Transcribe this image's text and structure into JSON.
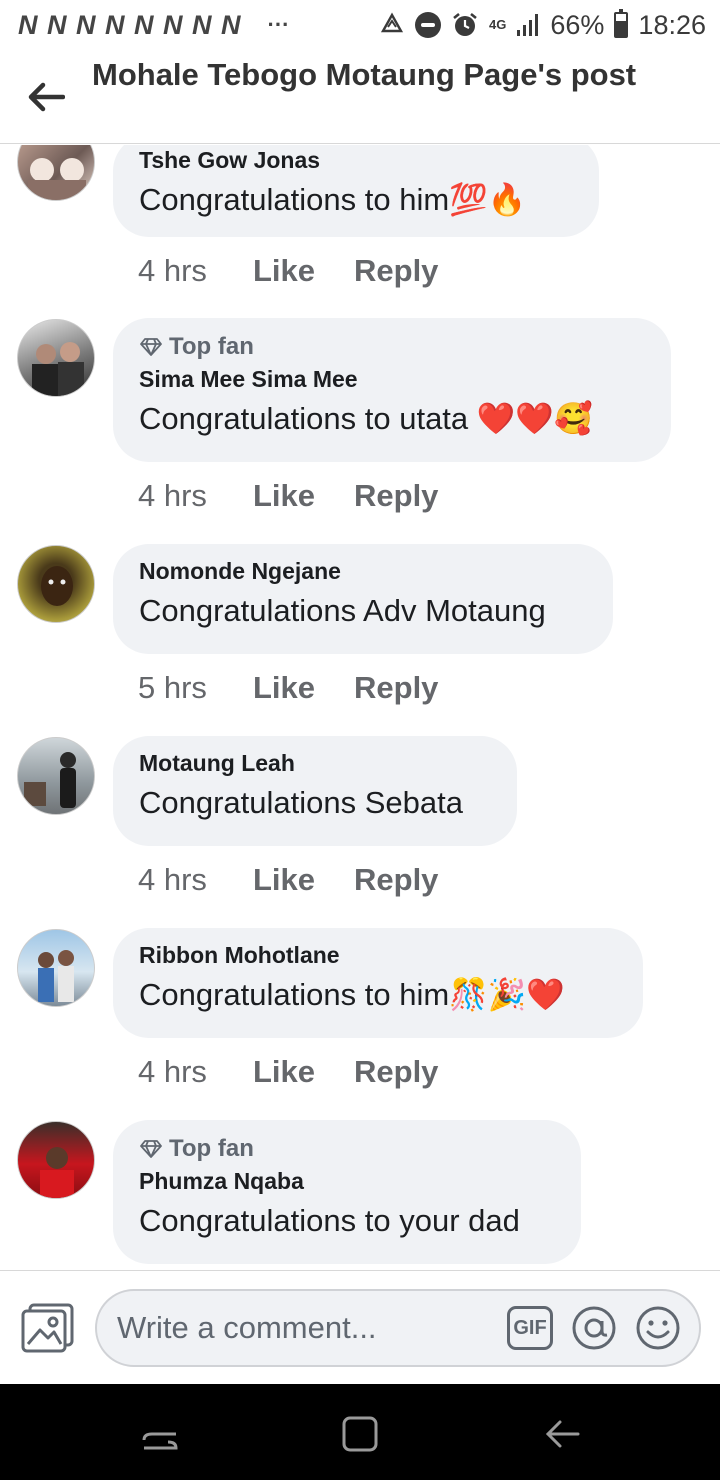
{
  "status_bar": {
    "notif_glyphs": "N N N N N N N N",
    "more": "···",
    "network": "4G",
    "battery": "66%",
    "time": "18:26"
  },
  "header": {
    "title": "Mohale Tebogo Motaung Page's post"
  },
  "comments": [
    {
      "author": "Tshe Gow Jonas",
      "text": "Congratulations to him💯🔥",
      "time": "4 hrs",
      "like": "Like",
      "reply": "Reply",
      "top_fan": ""
    },
    {
      "author": "Sima Mee Sima Mee",
      "text": "Congratulations to utata ❤️❤️🥰",
      "time": "4 hrs",
      "like": "Like",
      "reply": "Reply",
      "top_fan": "Top fan"
    },
    {
      "author": "Nomonde Ngejane",
      "text": "Congratulations Adv Motaung",
      "time": "5 hrs",
      "like": "Like",
      "reply": "Reply",
      "top_fan": ""
    },
    {
      "author": "Motaung Leah",
      "text": "Congratulations Sebata",
      "time": "4 hrs",
      "like": "Like",
      "reply": "Reply",
      "top_fan": ""
    },
    {
      "author": "Ribbon Mohotlane",
      "text": "Congratulations to him🎊🎉❤️",
      "time": "4 hrs",
      "like": "Like",
      "reply": "Reply",
      "top_fan": ""
    },
    {
      "author": "Phumza Nqaba",
      "text": "Congratulations to your dad",
      "time": "",
      "like": "",
      "reply": "",
      "top_fan": "Top fan"
    }
  ],
  "composer": {
    "placeholder": "Write a comment...",
    "gif_label": "GIF"
  },
  "colors": {
    "bubble": "#f0f2f5",
    "meta_text": "#65676b",
    "heart": "#e41e3f"
  }
}
